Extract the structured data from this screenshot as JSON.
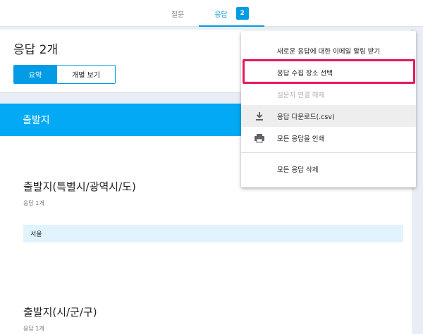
{
  "tabs": {
    "questions_label": "질문",
    "responses_label": "응답",
    "responses_count": "2"
  },
  "summary": {
    "title": "응답 2개",
    "summary_label": "요약",
    "individual_label": "개별 보기"
  },
  "section": {
    "title": "출발지"
  },
  "questions": [
    {
      "title": "출발지(특별시/광역시/도)",
      "count": "응답 1개",
      "answer": "서울"
    },
    {
      "title": "출발지(시/군/구)",
      "count": "응답 1개"
    }
  ],
  "menu": {
    "items": [
      {
        "label": "새로운 응답에 대한 이메일 알림 받기"
      },
      {
        "label": "응답 수집 장소 선택"
      },
      {
        "label": "설문지 연결 해제",
        "disabled": true
      },
      {
        "label": "응답 다운로드(.csv)",
        "icon": "download-icon"
      },
      {
        "label": "모든 응답을 인쇄",
        "icon": "print-icon"
      },
      {
        "label": "모든 응답 삭제"
      }
    ]
  },
  "colors": {
    "accent": "#039be5",
    "section": "#03a9f4",
    "highlight": "#e5185e",
    "answer_bg": "#e1f3fd"
  }
}
